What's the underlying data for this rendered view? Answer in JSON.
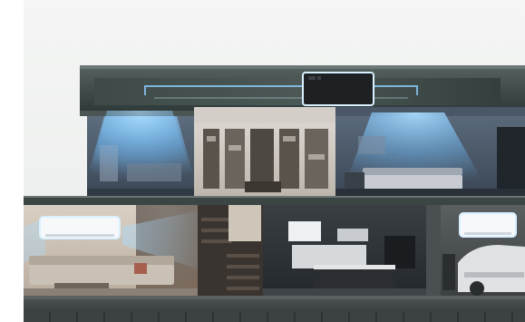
{
  "image": {
    "subject": "house-cutaway",
    "floors": 2,
    "air_conditioner_units": 3,
    "airflow_color": "#7ec8ff",
    "roof_color": "#3d4a48",
    "wall_color": "#2c3a3a",
    "floor_color": "#b8b1a6"
  }
}
